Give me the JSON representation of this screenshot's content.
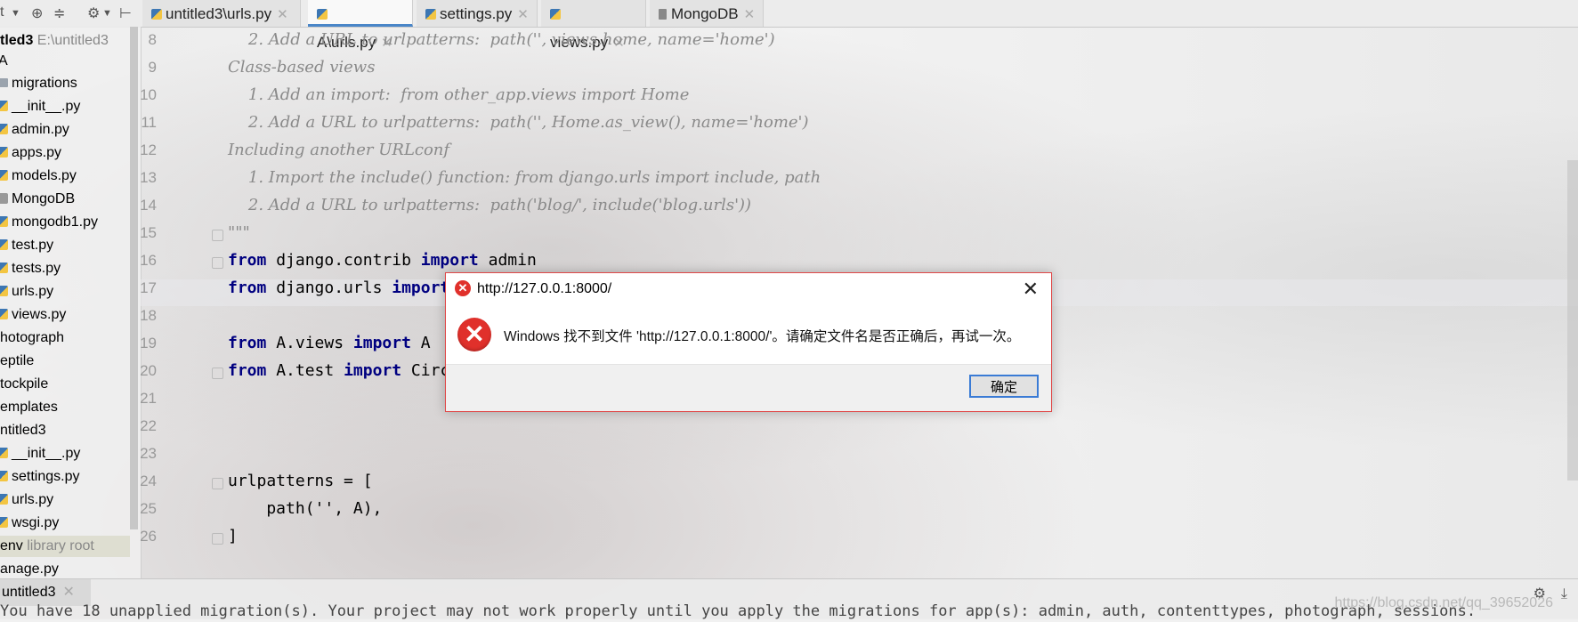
{
  "toolbar": {
    "left_fragment": "t",
    "tabs": [
      {
        "label": "untitled3\\urls.py",
        "icon": "python-file-icon"
      },
      {
        "label": "A\\urls.py",
        "icon": "python-file-icon"
      },
      {
        "label": "settings.py",
        "icon": "python-file-icon"
      },
      {
        "label": "views.py",
        "icon": "python-file-icon"
      },
      {
        "label": "MongoDB",
        "icon": "file-icon"
      }
    ]
  },
  "sidebar": {
    "root_name": "tled3",
    "root_path": "E:\\untitled3",
    "items": [
      {
        "label": "A",
        "type": "folder"
      },
      {
        "label": "migrations",
        "type": "folder"
      },
      {
        "label": "__init__.py",
        "type": "py"
      },
      {
        "label": "admin.py",
        "type": "py"
      },
      {
        "label": "apps.py",
        "type": "py"
      },
      {
        "label": "models.py",
        "type": "py"
      },
      {
        "label": "MongoDB",
        "type": "file"
      },
      {
        "label": "mongodb1.py",
        "type": "py"
      },
      {
        "label": "test.py",
        "type": "py"
      },
      {
        "label": "tests.py",
        "type": "py"
      },
      {
        "label": "urls.py",
        "type": "py"
      },
      {
        "label": "views.py",
        "type": "py"
      },
      {
        "label": "hotograph",
        "type": "folder"
      },
      {
        "label": "eptile",
        "type": "folder"
      },
      {
        "label": "tockpile",
        "type": "folder"
      },
      {
        "label": "emplates",
        "type": "folder"
      },
      {
        "label": "ntitled3",
        "type": "folder"
      },
      {
        "label": "__init__.py",
        "type": "py"
      },
      {
        "label": "settings.py",
        "type": "py"
      },
      {
        "label": "urls.py",
        "type": "py"
      },
      {
        "label": "wsgi.py",
        "type": "py"
      },
      {
        "label": "env",
        "type": "folder",
        "suffix": "library root"
      },
      {
        "label": "anage.py",
        "type": "py"
      }
    ]
  },
  "editor": {
    "lines": [
      {
        "num": "8",
        "text": "    2. Add a URL to urlpatterns:  path('', views.home, name='home')",
        "kind": "comment"
      },
      {
        "num": "9",
        "text": "Class-based views",
        "kind": "comment"
      },
      {
        "num": "10",
        "text": "    1. Add an import:  from other_app.views import Home",
        "kind": "comment"
      },
      {
        "num": "11",
        "text": "    2. Add a URL to urlpatterns:  path('', Home.as_view(), name='home')",
        "kind": "comment"
      },
      {
        "num": "12",
        "text": "Including another URLconf",
        "kind": "comment"
      },
      {
        "num": "13",
        "text": "    1. Import the include() function: from django.urls import include, path",
        "kind": "comment"
      },
      {
        "num": "14",
        "text": "    2. Add a URL to urlpatterns:  path('blog/', include('blog.urls'))",
        "kind": "comment"
      },
      {
        "num": "15",
        "text": "\"\"\"",
        "kind": "comment"
      },
      {
        "num": "16",
        "kw1": "from",
        "mid": " django.contrib ",
        "kw2": "import",
        "rest": " admin",
        "kind": "import"
      },
      {
        "num": "17",
        "kw1": "from",
        "mid": " django.urls ",
        "kw2": "import",
        "rest": "",
        "kind": "import"
      },
      {
        "num": "18",
        "text": "",
        "kind": "code"
      },
      {
        "num": "19",
        "kw1": "from",
        "mid": " A.views ",
        "kw2": "import",
        "rest": " A",
        "kind": "import"
      },
      {
        "num": "20",
        "kw1": "from",
        "mid": " A.test ",
        "kw2": "import",
        "rest": " Circ",
        "kind": "import"
      },
      {
        "num": "21",
        "text": "",
        "kind": "code"
      },
      {
        "num": "22",
        "text": "",
        "kind": "code"
      },
      {
        "num": "23",
        "text": "",
        "kind": "code"
      },
      {
        "num": "24",
        "text": "urlpatterns = [",
        "kind": "code"
      },
      {
        "num": "25",
        "text": "    path('', A),",
        "kind": "code"
      },
      {
        "num": "26",
        "text": "]",
        "kind": "code"
      }
    ]
  },
  "bottom": {
    "run_tab": "untitled3",
    "console_text": "You have 18 unapplied migration(s). Your project may not work properly until you apply the migrations for app(s): admin, auth, contenttypes, photograph, sessions.",
    "watermark": "https://blog.csdn.net/qq_39652026"
  },
  "dialog": {
    "title": "http://127.0.0.1:8000/",
    "message": "Windows 找不到文件 'http://127.0.0.1:8000/'。请确定文件名是否正确后，再试一次。",
    "ok_label": "确定",
    "accent": "#e0302b"
  }
}
